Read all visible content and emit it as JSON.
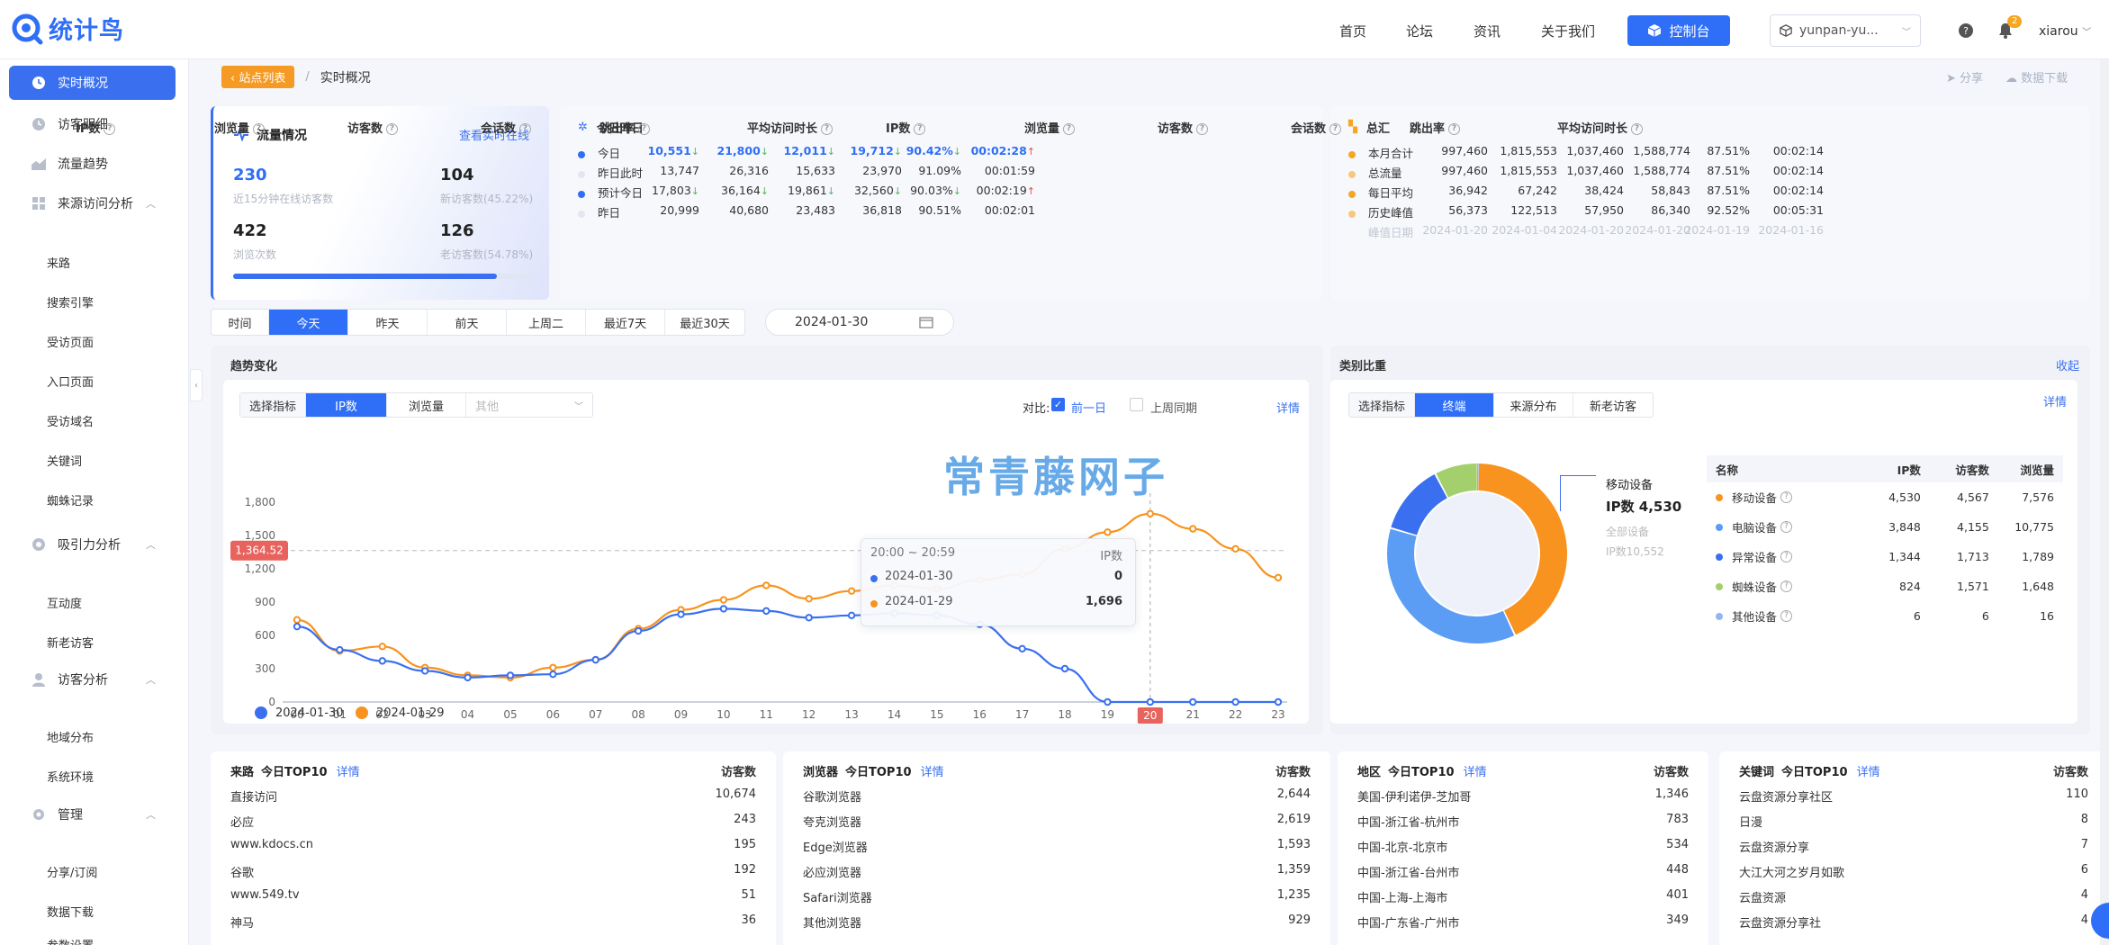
{
  "app": {
    "logo_text": "统计鸟",
    "watermark": "常青藤网子"
  },
  "topnav": {
    "items": [
      "首页",
      "论坛",
      "资讯",
      "关于我们"
    ],
    "console": "控制台",
    "site": "yunpan-yu...",
    "user": "xiarou",
    "bell_count": "2"
  },
  "sidebar": {
    "items": [
      {
        "label": "实时概况",
        "icon": "clock-icon",
        "active": true
      },
      {
        "label": "访客明细",
        "icon": "clock-icon"
      },
      {
        "label": "流量趋势",
        "icon": "trend-icon"
      },
      {
        "label": "来源访问分析",
        "icon": "grid-icon",
        "group": true
      },
      {
        "label": "吸引力分析",
        "icon": "target-icon",
        "group": true
      },
      {
        "label": "访客分析",
        "icon": "user-icon",
        "group": true
      },
      {
        "label": "管理",
        "icon": "gear-icon",
        "group": true
      }
    ],
    "source_sub": [
      "来路",
      "搜索引擎",
      "受访页面",
      "入口页面",
      "受访域名",
      "关键词",
      "蜘蛛记录"
    ],
    "attract_sub": [
      "互动度",
      "新老访客"
    ],
    "visitor_sub": [
      "地域分布",
      "系统环境"
    ],
    "manage_sub": [
      "分享/订阅",
      "数据下载",
      "参数设置"
    ]
  },
  "breadcrumb": {
    "back": "站点列表",
    "current": "实时概况"
  },
  "actions": {
    "share": "分享",
    "download": "数据下载"
  },
  "flow": {
    "title": "流量情况",
    "link": "查看实时在线",
    "online": "230",
    "online_label": "近15分钟在线访客数",
    "new_visitors": "104",
    "new_label": "新访客数(45.22%)",
    "pv": "422",
    "pv_label": "浏览次数",
    "old_visitors": "126",
    "old_label": "老访客数(54.78%)",
    "progress": 0.88
  },
  "today_table": {
    "title": "今日昨日",
    "headers": [
      "IP数",
      "浏览量",
      "访客数",
      "会话数",
      "跳出率",
      "平均访问时长"
    ],
    "rows": [
      {
        "label": "今日",
        "dot": "#2f6ef6",
        "vals": [
          "10,551",
          "21,800",
          "12,011",
          "19,712",
          "90.42%",
          "00:02:28"
        ],
        "marks": [
          "down",
          "down",
          "down",
          "down",
          "down",
          "up"
        ],
        "bold": true
      },
      {
        "label": "昨日此时",
        "dot": "#e3e7f2",
        "vals": [
          "13,747",
          "26,316",
          "15,633",
          "23,970",
          "91.09%",
          "00:01:59"
        ],
        "marks": [
          "",
          "",
          "",
          "",
          "",
          ""
        ]
      },
      {
        "label": "预计今日",
        "dot": "#2f6ef6",
        "vals": [
          "17,803",
          "36,164",
          "19,861",
          "32,560",
          "90.03%",
          "00:02:19"
        ],
        "marks": [
          "down",
          "down",
          "down",
          "down",
          "down",
          "up"
        ]
      },
      {
        "label": "昨日",
        "dot": "#e3e7f2",
        "vals": [
          "20,999",
          "40,680",
          "23,483",
          "36,818",
          "90.51%",
          "00:02:01"
        ],
        "marks": [
          "",
          "",
          "",
          "",
          "",
          ""
        ]
      }
    ]
  },
  "total_table": {
    "title": "总汇",
    "headers": [
      "IP数",
      "浏览量",
      "访客数",
      "会话数",
      "跳出率",
      "平均访问时长"
    ],
    "rows": [
      {
        "label": "本月合计",
        "dot": "#f5a623",
        "vals": [
          "997,460",
          "1,815,553",
          "1,037,460",
          "1,588,774",
          "87.51%",
          "00:02:14"
        ]
      },
      {
        "label": "总流量",
        "dot": "#f7c87a",
        "vals": [
          "997,460",
          "1,815,553",
          "1,037,460",
          "1,588,774",
          "87.51%",
          "00:02:14"
        ]
      },
      {
        "label": "每日平均",
        "dot": "#f5a623",
        "vals": [
          "36,942",
          "67,242",
          "38,424",
          "58,843",
          "87.51%",
          "00:02:14"
        ]
      },
      {
        "label": "历史峰值",
        "dot": "#f7c87a",
        "vals": [
          "56,373",
          "122,513",
          "57,950",
          "86,340",
          "92.52%",
          "00:05:31"
        ]
      },
      {
        "label": "峰值日期",
        "dot": "",
        "vals": [
          "2024-01-20",
          "2024-01-04",
          "2024-01-20",
          "2024-01-20",
          "2024-01-19",
          "2024-01-16"
        ],
        "muted": true
      }
    ]
  },
  "time_tabs": {
    "items": [
      "时间",
      "今天",
      "昨天",
      "前天",
      "上周二",
      "最近7天",
      "最近30天"
    ],
    "active": 1,
    "date": "2024-01-30"
  },
  "trend": {
    "title": "趋势变化",
    "select_label": "选择指标",
    "options": [
      "IP数",
      "浏览量"
    ],
    "other": "其他",
    "compare_label": "对比:",
    "compare_prev": "前一日",
    "compare_week": "上周同期",
    "detail": "详情",
    "tooltip": {
      "range": "20:00 ~ 20:59",
      "metric": "IP数",
      "rows": [
        {
          "date": "2024-01-30",
          "value": "0",
          "color": "#3a70f0"
        },
        {
          "date": "2024-01-29",
          "value": "1,696",
          "color": "#f7931e"
        }
      ]
    },
    "ref_label": "1,364.52",
    "hover_x": "20"
  },
  "chart_data": {
    "type": "line",
    "x": [
      "00",
      "01",
      "02",
      "03",
      "04",
      "05",
      "06",
      "07",
      "08",
      "09",
      "10",
      "11",
      "12",
      "13",
      "14",
      "15",
      "16",
      "17",
      "18",
      "19",
      "20",
      "21",
      "22",
      "23"
    ],
    "series": [
      {
        "name": "2024-01-30",
        "color": "#3a70f0",
        "values": [
          680,
          470,
          370,
          280,
          220,
          240,
          250,
          380,
          640,
          790,
          840,
          820,
          760,
          780,
          800,
          780,
          700,
          480,
          300,
          0,
          0,
          0,
          0,
          0
        ]
      },
      {
        "name": "2024-01-29",
        "color": "#f7931e",
        "values": [
          740,
          460,
          500,
          310,
          240,
          220,
          310,
          380,
          660,
          830,
          920,
          1050,
          930,
          1000,
          1050,
          1020,
          1100,
          1150,
          1380,
          1530,
          1696,
          1560,
          1380,
          1120
        ]
      }
    ],
    "ylim": [
      0,
      1800
    ],
    "yticks": [
      "0",
      "300",
      "600",
      "900",
      "1,200",
      "1,500",
      "1,800"
    ],
    "reference_line": 1364.52
  },
  "category": {
    "title": "类别比重",
    "collapse": "收起",
    "select_label": "选择指标",
    "tabs": [
      "终端",
      "来源分布",
      "新老访客"
    ],
    "detail": "详情",
    "callout": {
      "name": "移动设备",
      "value": "IP数 4,530",
      "total_label": "全部设备",
      "total": "IP数10,552"
    },
    "headers": [
      "名称",
      "IP数",
      "访客数",
      "浏览量"
    ],
    "rows": [
      {
        "name": "移动设备",
        "color": "#f7931e",
        "vals": [
          "4,530",
          "4,567",
          "7,576"
        ]
      },
      {
        "name": "电脑设备",
        "color": "#5b9cf5",
        "vals": [
          "3,848",
          "4,155",
          "10,775"
        ]
      },
      {
        "name": "异常设备",
        "color": "#3a70f0",
        "vals": [
          "1,344",
          "1,713",
          "1,789"
        ]
      },
      {
        "name": "蜘蛛设备",
        "color": "#a4cf6d",
        "vals": [
          "824",
          "1,571",
          "1,648"
        ]
      },
      {
        "name": "其他设备",
        "color": "#8fb7f3",
        "vals": [
          "6",
          "6",
          "16"
        ]
      }
    ],
    "donut": [
      4530,
      3848,
      1344,
      824,
      6
    ]
  },
  "panels": [
    {
      "title": "来路",
      "sub": "今日TOP10",
      "link": "详情",
      "col": "访客数",
      "rows": [
        [
          "直接访问",
          "10,674"
        ],
        [
          "必应",
          "243"
        ],
        [
          "www.kdocs.cn",
          "195"
        ],
        [
          "谷歌",
          "192"
        ],
        [
          "www.549.tv",
          "51"
        ],
        [
          "神马",
          "36"
        ]
      ]
    },
    {
      "title": "浏览器",
      "sub": "今日TOP10",
      "link": "详情",
      "col": "访客数",
      "rows": [
        [
          "谷歌浏览器",
          "2,644"
        ],
        [
          "夸克浏览器",
          "2,619"
        ],
        [
          "Edge浏览器",
          "1,593"
        ],
        [
          "必应浏览器",
          "1,359"
        ],
        [
          "Safari浏览器",
          "1,235"
        ],
        [
          "其他浏览器",
          "929"
        ]
      ]
    },
    {
      "title": "地区",
      "sub": "今日TOP10",
      "link": "详情",
      "col": "访客数",
      "rows": [
        [
          "美国-伊利诺伊-芝加哥",
          "1,346"
        ],
        [
          "中国-浙江省-杭州市",
          "783"
        ],
        [
          "中国-北京-北京市",
          "534"
        ],
        [
          "中国-浙江省-台州市",
          "448"
        ],
        [
          "中国-上海-上海市",
          "401"
        ],
        [
          "中国-广东省-广州市",
          "349"
        ]
      ]
    },
    {
      "title": "关键词",
      "sub": "今日TOP10",
      "link": "详情",
      "col": "访客数",
      "rows": [
        [
          "云盘资源分享社区",
          "110"
        ],
        [
          "日漫",
          "8"
        ],
        [
          "云盘资源分享",
          "7"
        ],
        [
          "大江大河之岁月如歌",
          "6"
        ],
        [
          "云盘资源",
          "4"
        ],
        [
          "云盘资源分享社",
          "4"
        ]
      ]
    }
  ]
}
